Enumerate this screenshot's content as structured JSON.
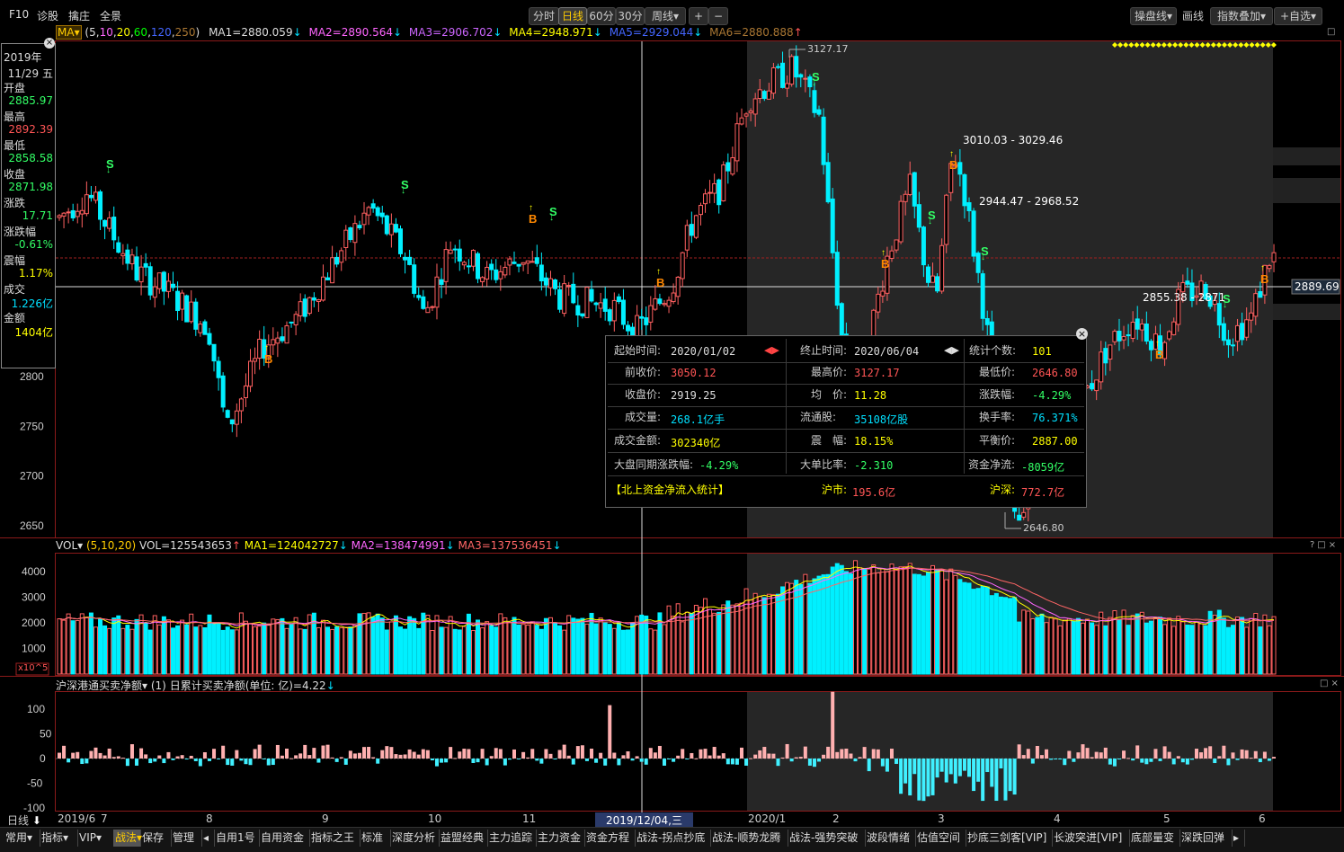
{
  "topbar": {
    "left_items": [
      "F10",
      "诊股",
      "擒庄",
      "全景"
    ],
    "periods": [
      "分时",
      "日线",
      "60分",
      "30分",
      "周线▾"
    ],
    "active_period": "日线",
    "zoom": [
      "+",
      "−"
    ],
    "right_items": [
      "操盘线▾",
      "画线",
      "指数叠加▾",
      "+自选▾"
    ]
  },
  "ma_bar": {
    "name": "MA▾",
    "params_open": "(",
    "params": [
      "5",
      "10",
      "20",
      "60",
      "120",
      "250"
    ],
    "params_close": ")",
    "ma1": "MA1=2880.059",
    "ma2": "MA2=2890.564",
    "ma3": "MA3=2906.702",
    "ma4": "MA4=2948.971",
    "ma5": "MA5=2929.044",
    "ma6": "MA6=2880.888",
    "arrows": [
      "↓",
      "↓",
      "↓",
      "↓",
      "↓",
      "↑"
    ]
  },
  "info_panel": {
    "year": "2019年",
    "date": "11/29 五",
    "open_label": "开盘",
    "open": "2885.97",
    "high_label": "最高",
    "high": "2892.39",
    "low_label": "最低",
    "low": "2858.58",
    "close_label": "收盘",
    "close": "2871.98",
    "chg_label": "涨跌",
    "chg": "17.71",
    "chgpct_label": "涨跌幅",
    "chgpct": "-0.61%",
    "amp_label": "震幅",
    "amp": "1.17%",
    "vol_label": "成交",
    "vol": "1.226亿",
    "amt_label": "金额",
    "amt": "1404亿"
  },
  "price_axis": {
    "labels": [
      "2800",
      "2750",
      "2700",
      "2650"
    ],
    "current": "2889.69"
  },
  "annotations": {
    "high_label": "3127.17",
    "low_label": "2646.80",
    "range1": "3010.03 - 3029.46",
    "range2": "2944.47 - 2968.52",
    "range3": "2855.38 - 2871",
    "buy_marker": "B",
    "sell_marker": "S"
  },
  "popup": {
    "start_label": "起始时间:",
    "start": "2020/01/02",
    "end_label": "终止时间:",
    "end": "2020/06/04",
    "count_label": "统计个数:",
    "count": "101",
    "prev_close_label": "前收价:",
    "prev_close": "3050.12",
    "high_label": "最高价:",
    "high": "3127.17",
    "low_label": "最低价:",
    "low": "2646.80",
    "close_label": "收盘价:",
    "close": "2919.25",
    "avg_label": "均　价:",
    "avg": "11.28",
    "chg_label": "涨跌幅:",
    "chg": "-4.29%",
    "vol_label": "成交量:",
    "vol": "268.1亿手",
    "float_label": "流通股:",
    "float": "35108亿股",
    "turnover_label": "换手率:",
    "turnover": "76.371%",
    "amt_label": "成交金额:",
    "amt": "302340亿",
    "amp_label": "震　幅:",
    "amp": "18.15%",
    "balance_label": "平衡价:",
    "balance": "2887.00",
    "market_chg_label": "大盘同期涨跌幅:",
    "market_chg": "-4.29%",
    "big_ratio_label": "大单比率:",
    "big_ratio": "-2.310",
    "netflow_label": "资金净流:",
    "netflow": "-8059亿",
    "north_label": "【北上资金净流入统计】",
    "sh_label": "沪市:",
    "sh": "195.6亿",
    "hs_label": "沪深:",
    "hs": "772.7亿",
    "close_icon": "×"
  },
  "vol_panel": {
    "name": "VOL▾",
    "params": "(5,10,20)",
    "vol": "VOL=125543653",
    "ma1": "MA1=124042727",
    "ma2": "MA2=138474991",
    "ma3": "MA3=137536451",
    "arrows": [
      "↑",
      "↓",
      "↓",
      "↓"
    ],
    "axis": [
      "4000",
      "3000",
      "2000",
      "1000"
    ],
    "unit": "x10^5"
  },
  "flow_panel": {
    "title": "沪深港通买卖净额▾",
    "param": "(1)",
    "text": "日累计买卖净额(单位: 亿)=4.22",
    "arrow": "↓",
    "axis": [
      "100",
      "50",
      "0",
      "-50",
      "-100"
    ]
  },
  "x_axis": {
    "period_label": "日线",
    "labels": [
      "2019/6",
      "7",
      "8",
      "9",
      "10",
      "11",
      "2019/12/04,三",
      "2020/1",
      "2",
      "3",
      "4",
      "5",
      "6"
    ]
  },
  "bottom_tabs": [
    "常用▾",
    "指标▾",
    "VIP▾",
    "战法▾",
    "保存",
    "管理",
    "◂",
    "自用1号",
    "自用资金",
    "指标之王",
    "标准",
    "深度分析",
    "益盟经典",
    "主力追踪",
    "主力资金",
    "资金方程",
    "战法-拐点抄底",
    "战法-顺势龙腾",
    "战法-强势突破",
    "波段情绪",
    "估值空间",
    "抄底三剑客[VIP]",
    "长波突进[VIP]",
    "底部量变",
    "深跌回弹",
    "▸"
  ],
  "active_tab": "战法▾",
  "colors": {
    "up": "#ff6060",
    "down": "#00f0ff",
    "bg": "#000000",
    "shade": "#2a2a2a",
    "grid": "#8b0000",
    "yellow": "#ffff00"
  },
  "chart_data": {
    "type": "candlestick",
    "title": "",
    "x_range": [
      "2019/6",
      "2020/6"
    ],
    "y_range": [
      2620,
      3140
    ],
    "selected_range": {
      "start": "2020/01/02",
      "end": "2020/06/04"
    },
    "crosshair": {
      "date": "2019/12/04,三",
      "price": 2889.69
    },
    "key_points": [
      {
        "label": "high",
        "value": 3127.17
      },
      {
        "label": "low",
        "value": 2646.8
      },
      {
        "label": "last",
        "value": 2889.69
      }
    ]
  }
}
